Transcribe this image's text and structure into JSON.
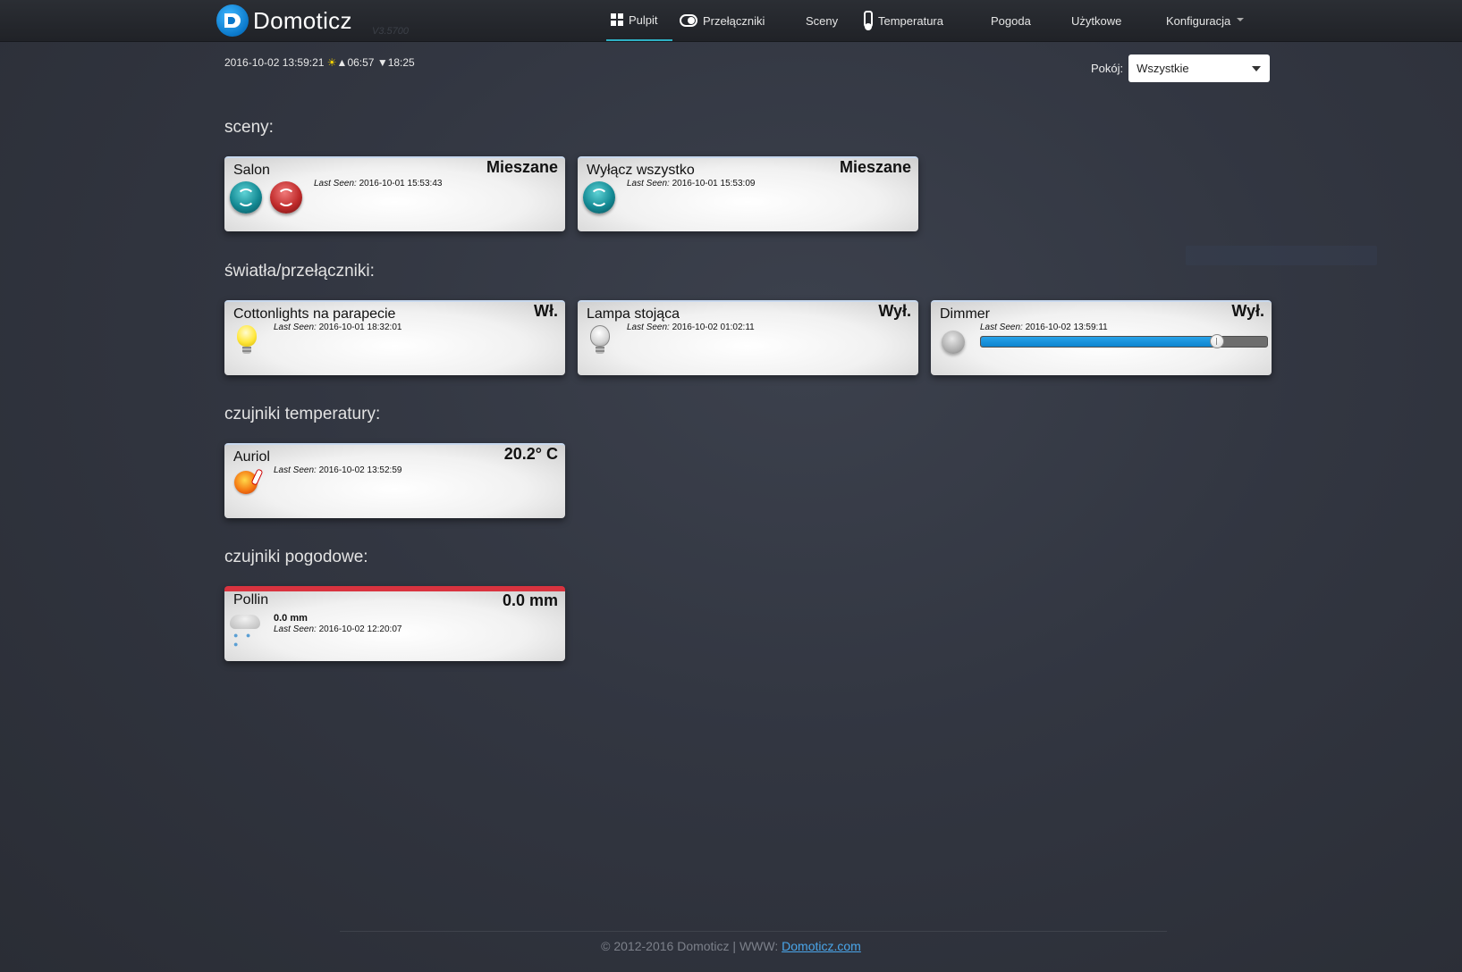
{
  "app": {
    "brand": "Domoticz",
    "version": "V3.5700"
  },
  "nav": {
    "items": [
      {
        "label": "Pulpit",
        "icon": "dashboard-icon",
        "active": true
      },
      {
        "label": "Przełączniki",
        "icon": "toggle-icon"
      },
      {
        "label": "Sceny"
      },
      {
        "label": "Temperatura",
        "icon": "thermometer-icon"
      },
      {
        "label": "Pogoda"
      },
      {
        "label": "Użytkowe"
      },
      {
        "label": "Konfiguracja",
        "dropdown": true
      }
    ]
  },
  "status": {
    "datetime": "2016-10-02 13:59:21",
    "sunrise": "06:57",
    "sunset": "18:25"
  },
  "room": {
    "label": "Pokój:",
    "selected": "Wszystkie"
  },
  "sections": {
    "scenes": {
      "title": "sceny:",
      "cards": [
        {
          "name": "Salon",
          "status": "Mieszane",
          "last_seen_label": "Last Seen:",
          "last_seen": "2016-10-01 15:53:43"
        },
        {
          "name": "Wyłącz wszystko",
          "status": "Mieszane",
          "last_seen_label": "Last Seen:",
          "last_seen": "2016-10-01 15:53:09"
        }
      ]
    },
    "lights": {
      "title": "światła/przełączniki:",
      "cards": [
        {
          "name": "Cottonlights na parapecie",
          "status": "Wł.",
          "last_seen_label": "Last Seen:",
          "last_seen": "2016-10-01 18:32:01"
        },
        {
          "name": "Lampa stojąca",
          "status": "Wył.",
          "last_seen_label": "Last Seen:",
          "last_seen": "2016-10-02 01:02:11"
        },
        {
          "name": "Dimmer",
          "status": "Wył.",
          "last_seen_label": "Last Seen:",
          "last_seen": "2016-10-02 13:59:11",
          "level": 0.82
        }
      ]
    },
    "temperature": {
      "title": "czujniki temperatury:",
      "cards": [
        {
          "name": "Auriol",
          "status": "20.2° C",
          "last_seen_label": "Last Seen:",
          "last_seen": "2016-10-02 13:52:59"
        }
      ]
    },
    "weather": {
      "title": "czujniki pogodowe:",
      "cards": [
        {
          "name": "Pollin",
          "status": "0.0 mm",
          "value": "0.0 mm",
          "last_seen_label": "Last Seen:",
          "last_seen": "2016-10-02 12:20:07"
        }
      ]
    }
  },
  "footer": {
    "text": "© 2012-2016 Domoticz | WWW: ",
    "link": "Domoticz.com"
  },
  "colors": {
    "accent": "#2eb0c4",
    "slider_fill": "#0d84cf",
    "alert": "#d9333f",
    "link": "#4aa6ea"
  }
}
